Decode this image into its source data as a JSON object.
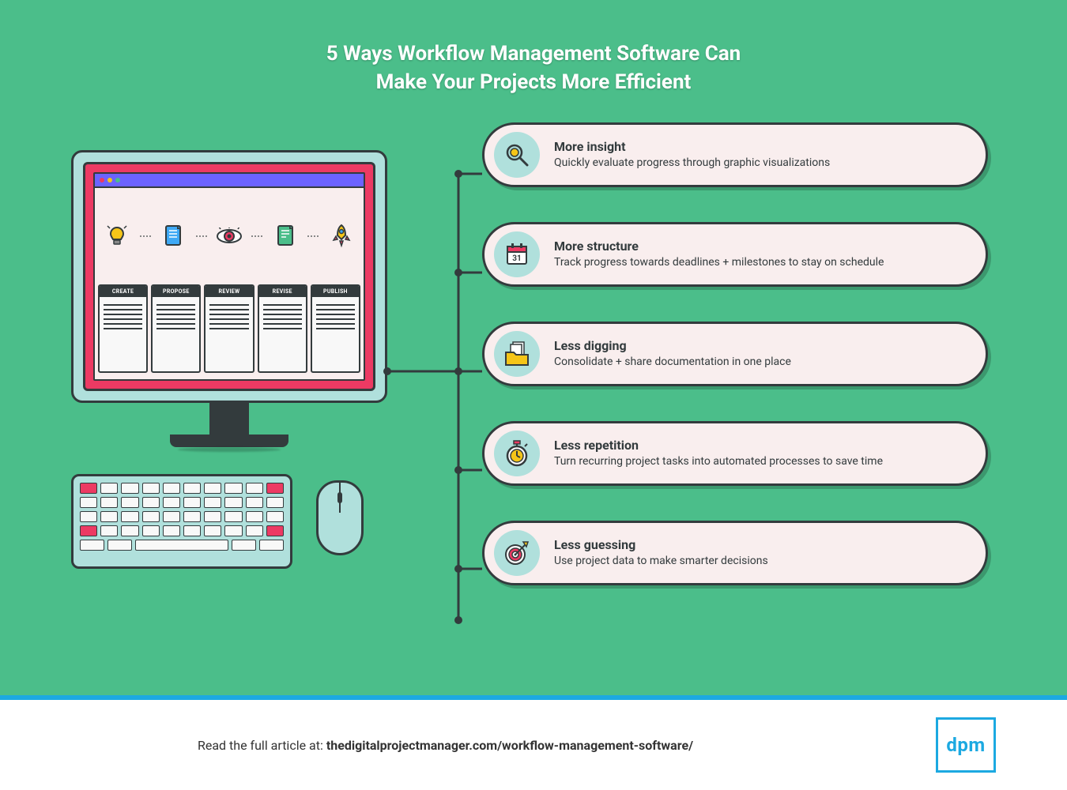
{
  "title": {
    "line1": "5 Ways Workflow Management Software Can",
    "line2": "Make Your Projects More Efficient"
  },
  "workflow_steps": [
    "CREATE",
    "PROPOSE",
    "REVIEW",
    "REVISE",
    "PUBLISH"
  ],
  "workflow_icons": [
    "lightbulb-icon",
    "document-icon",
    "eye-icon",
    "document-check-icon",
    "rocket-icon"
  ],
  "points": [
    {
      "icon": "magnifier-icon",
      "heading": "More insight",
      "body": "Quickly evaluate progress through graphic visualizations"
    },
    {
      "icon": "calendar-icon",
      "calendar_day": "31",
      "heading": "More structure",
      "body": "Track progress towards deadlines + milestones to stay on schedule"
    },
    {
      "icon": "folder-files-icon",
      "heading": "Less digging",
      "body": "Consolidate + share documentation in one place"
    },
    {
      "icon": "stopwatch-icon",
      "heading": "Less repetition",
      "body": "Turn recurring project tasks into automated processes to save time"
    },
    {
      "icon": "target-icon",
      "heading": "Less guessing",
      "body": "Use project data to make smarter decisions"
    }
  ],
  "footer": {
    "read_label": "Read the full article at: ",
    "url": "thedigitalprojectmanager.com/workflow-management-software/",
    "logo": "dpm"
  }
}
